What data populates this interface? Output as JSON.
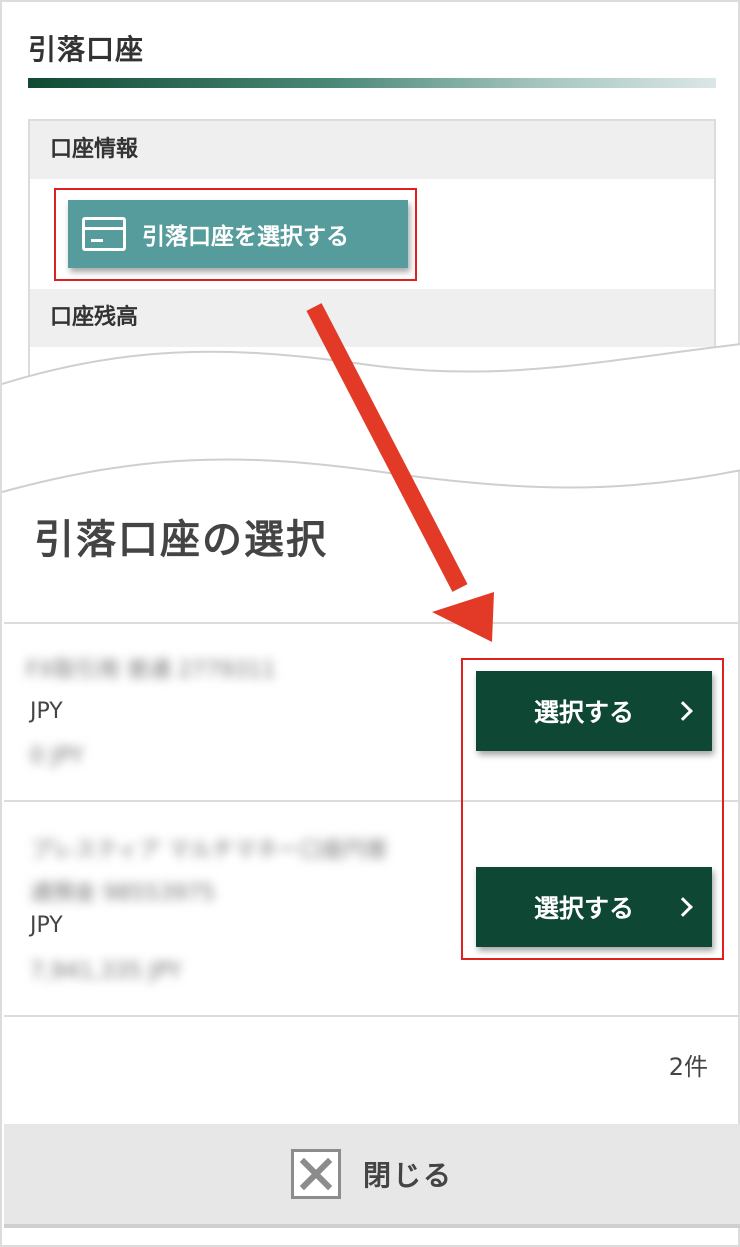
{
  "section": {
    "title": "引落口座",
    "account_info_label": "口座情報",
    "select_account_button": "引落口座を選択する",
    "balance_label": "口座残高"
  },
  "modal": {
    "title": "引落口座の選択",
    "accounts": [
      {
        "name_blurred": "FX取引用 普通 2779311",
        "currency": "JPY",
        "balance_blurred": "0 JPY",
        "select_label": "選択する"
      },
      {
        "name_blurred_line1": "プレスティア マルチマネー口座円普",
        "name_blurred_line2": "通預金 98553975",
        "currency": "JPY",
        "balance_blurred": "7,941,335 JPY",
        "select_label": "選択する"
      }
    ],
    "count": "2件",
    "close_label": "閉じる"
  },
  "colors": {
    "highlight": "#e02020",
    "primary_button": "#0e4733",
    "teal_button": "#579c9c"
  }
}
